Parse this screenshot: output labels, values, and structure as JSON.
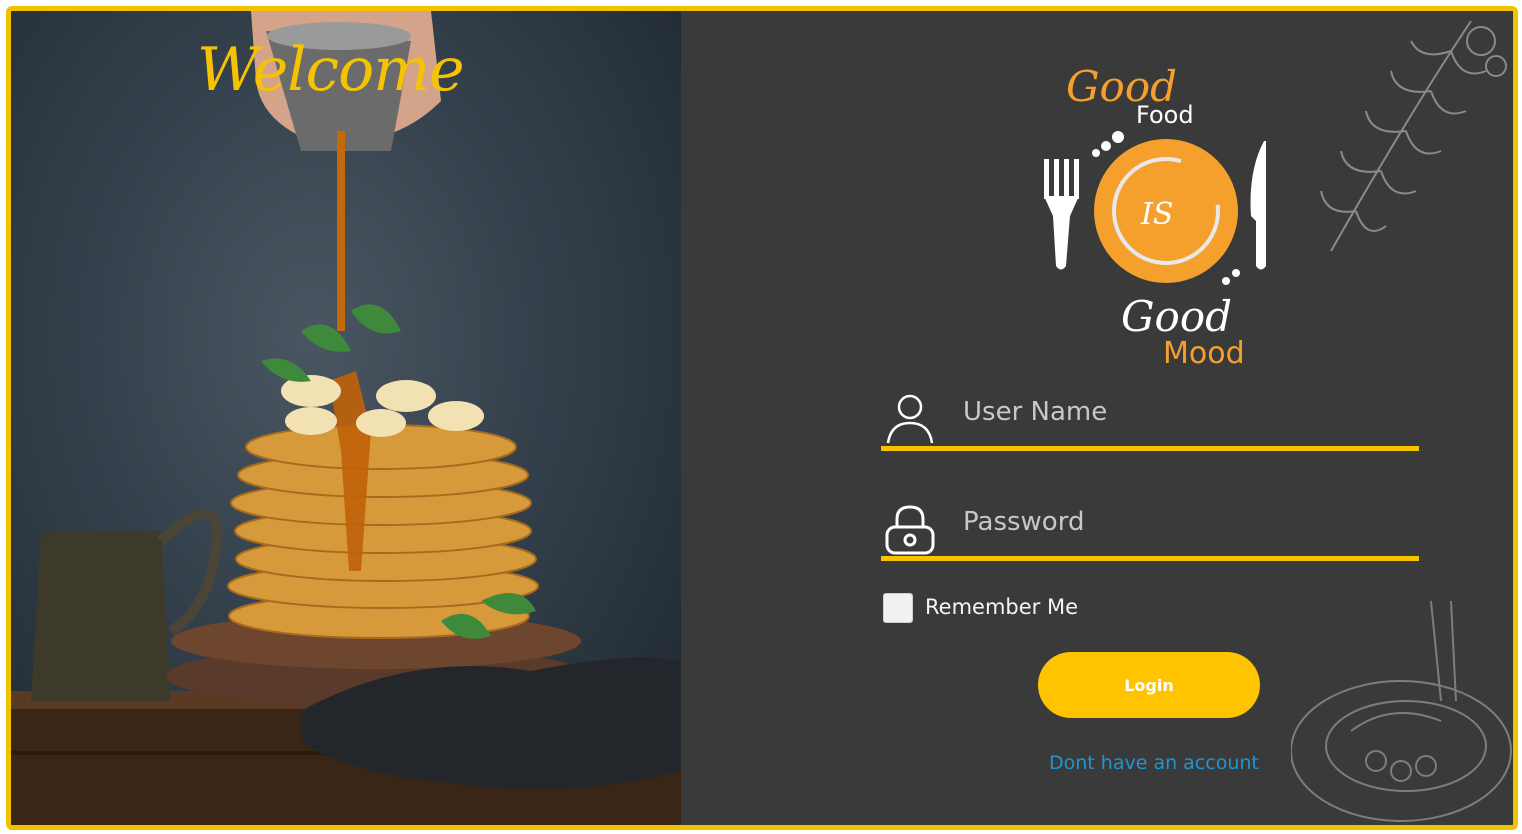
{
  "welcome": {
    "title": "Welcome"
  },
  "logo": {
    "line1": "Good",
    "line2": "Food",
    "plate_text": "IS",
    "line3": "Good",
    "line4": "Mood"
  },
  "form": {
    "username": {
      "placeholder": "User Name",
      "icon": "user-icon"
    },
    "password": {
      "placeholder": "Password",
      "icon": "lock-icon"
    },
    "remember_label": "Remember Me",
    "remember_checked": false,
    "login_label": "Login",
    "signup_link": "Dont have an account"
  },
  "colors": {
    "accent": "#f6c300",
    "panel": "#3a3a3a",
    "logo_orange": "#f5a02d",
    "link": "#1e96d2"
  }
}
